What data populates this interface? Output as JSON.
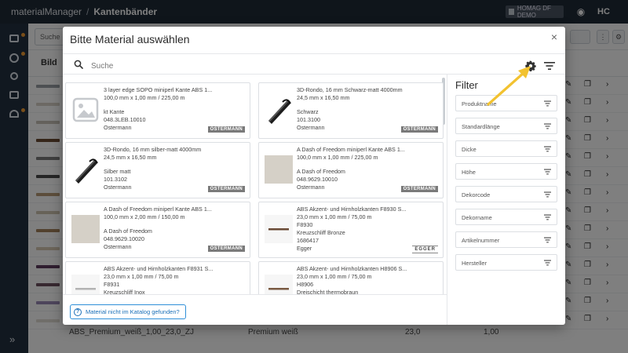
{
  "app": {
    "name": "materialManager",
    "separator": "/",
    "page": "Kantenbänder",
    "tenant": "HOMAG DF DEMO",
    "brand": "HC",
    "search_placeholder": "Suche",
    "table_header_bild": "Bild",
    "last_row": {
      "name": "ABS_Premium_weiß_1,00_23,0_ZJ",
      "decor": "Premium weiß",
      "width": "23,0",
      "thickness": "1,00"
    }
  },
  "modal": {
    "title": "Bitte Material auswählen",
    "close": "×",
    "search_placeholder": "Suche",
    "not_found_label": "Material nicht im Katalog gefunden?",
    "filter_title": "Filter",
    "filters": [
      "Produktname",
      "Standardlänge",
      "Dicke",
      "Höhe",
      "Dekorcode",
      "Dekorname",
      "Artikelnummer",
      "Hersteller"
    ],
    "cards": [
      {
        "title": "3 layer edge SOPO miniperl Kante ABS 1...",
        "dims": "100,0 mm x 1,00 mm / 225,00 m",
        "code": "",
        "decor": "kt Kante",
        "article": "048.3LEB.10010",
        "maker": "Ostermann",
        "logo": "OSTERMANN",
        "thumb": "placeholder"
      },
      {
        "title": "3D-Rondo, 16 mm Schwarz-matt 4000mm",
        "dims": "24,5 mm x 16,50 mm",
        "code": "",
        "decor": "Schwarz",
        "article": "101.3100",
        "maker": "Ostermann",
        "logo": "OSTERMANN",
        "thumb": "rondo-black"
      },
      {
        "title": "3D-Rondo, 16 mm silber-matt 4000mm",
        "dims": "24,5 mm x 16,50 mm",
        "code": "",
        "decor": "Silber matt",
        "article": "101.3102",
        "maker": "Ostermann",
        "logo": "OSTERMANN",
        "thumb": "rondo-black"
      },
      {
        "title": "A Dash of Freedom miniperl Kante ABS 1...",
        "dims": "100,0 mm x 1,00 mm / 225,00 m",
        "code": "",
        "decor": "A Dash of Freedom",
        "article": "048.9629.10010",
        "maker": "Ostermann",
        "logo": "OSTERMANN",
        "thumb": "stone"
      },
      {
        "title": "A Dash of Freedom miniperl Kante ABS 1...",
        "dims": "100,0 mm x 2,00 mm / 150,00 m",
        "code": "",
        "decor": "A Dash of Freedom",
        "article": "048.9629.10020",
        "maker": "Ostermann",
        "logo": "OSTERMANN",
        "thumb": "stone"
      },
      {
        "title": "ABS Akzent- und Hirnholzkanten F8930 S...",
        "dims": "23,0 mm x 1,00 mm / 75,00 m",
        "code": "F8930",
        "decor": "Kreuzschliff Bronze",
        "article": "1686417",
        "maker": "Egger",
        "logo": "EGGER",
        "thumb": "strip-bronze"
      },
      {
        "title": "ABS Akzent- und Hirnholzkanten F8931 S...",
        "dims": "23,0 mm x 1,00 mm / 75,00 m",
        "code": "F8931",
        "decor": "Kreuzschliff Inox",
        "article": "",
        "maker": "",
        "logo": "",
        "thumb": "strip-inox"
      },
      {
        "title": "ABS Akzent- und Hirnholzkanten H8906 S...",
        "dims": "23,0 mm x 1,00 mm / 75,00 m",
        "code": "H8906",
        "decor": "Dreischicht thermobraun",
        "article": "",
        "maker": "",
        "logo": "",
        "thumb": "strip-brown"
      }
    ]
  },
  "colors": {
    "topbar": "#1f2a36",
    "accent": "#2f8fd8",
    "annotation_arrow": "#f2c230",
    "nav_dot": "#f39c32"
  }
}
